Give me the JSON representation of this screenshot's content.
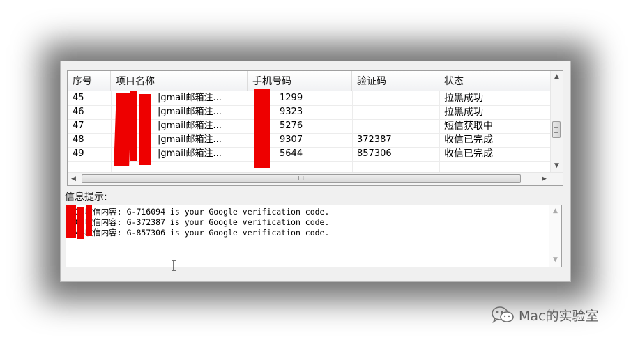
{
  "table": {
    "columns": [
      "序号",
      "项目名称",
      "手机号码",
      "验证码",
      "状态"
    ],
    "rows": [
      {
        "index": "45",
        "project": "|gmail邮箱注...",
        "phone": "1299",
        "code": "",
        "status": "拉黑成功"
      },
      {
        "index": "46",
        "project": "|gmail邮箱注...",
        "phone": "9323",
        "code": "",
        "status": "拉黑成功"
      },
      {
        "index": "47",
        "project": "|gmail邮箱注...",
        "phone": "5276",
        "code": "",
        "status": "短信获取中"
      },
      {
        "index": "48",
        "project": "|gmail邮箱注...",
        "phone": "9307",
        "code": "372387",
        "status": "收信已完成"
      },
      {
        "index": "49",
        "project": "|gmail邮箱注...",
        "phone": "5644",
        "code": "857306",
        "status": "收信已完成"
      }
    ],
    "hscroll_grip": "III"
  },
  "info": {
    "label": "信息提示:",
    "messages": [
      "337收信内容: G-716094 is your Google verification code.",
      "307收信内容: G-372387 is your Google verification code.",
      "644收信内容: G-857306 is your Google verification code."
    ]
  },
  "watermark": {
    "text": "Mac的实验室",
    "icon": "wechat-icon"
  },
  "colors": {
    "redaction": "#ee0000",
    "window_bg": "#f0f0f0"
  }
}
